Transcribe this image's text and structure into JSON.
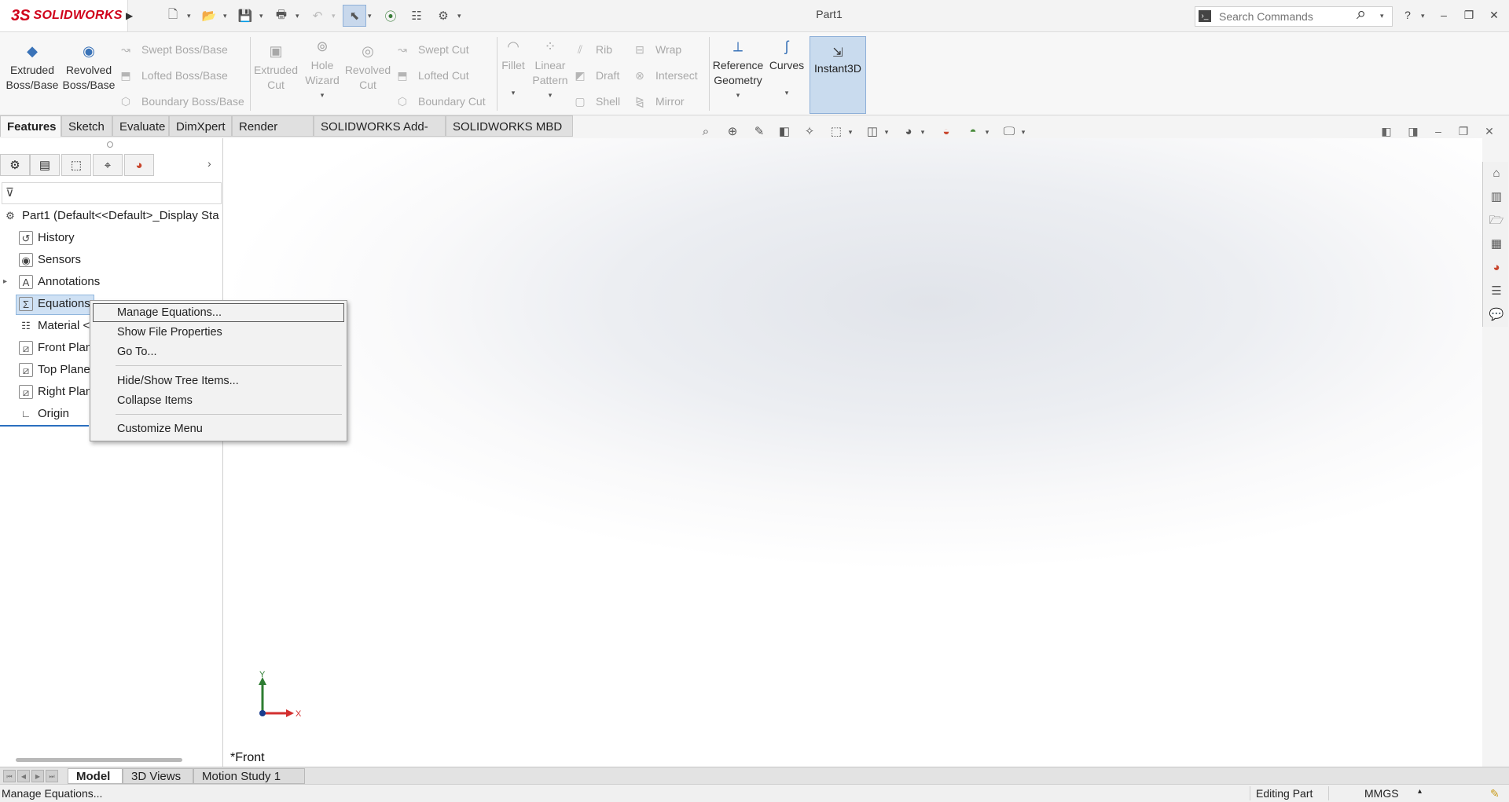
{
  "app": {
    "brand": "SOLIDWORKS",
    "title": "Part1",
    "search_placeholder": "Search Commands",
    "help_label": "?"
  },
  "ribbon": {
    "extruded_boss": "Extruded Boss/Base",
    "revolved_boss": "Revolved Boss/Base",
    "swept_boss": "Swept Boss/Base",
    "lofted_boss": "Lofted Boss/Base",
    "boundary_boss": "Boundary Boss/Base",
    "extruded_cut": "Extruded Cut",
    "hole_wizard": "Hole Wizard",
    "revolved_cut": "Revolved Cut",
    "swept_cut": "Swept Cut",
    "lofted_cut": "Lofted Cut",
    "boundary_cut": "Boundary Cut",
    "fillet": "Fillet",
    "linear_pattern": "Linear Pattern",
    "rib": "Rib",
    "draft": "Draft",
    "shell": "Shell",
    "wrap": "Wrap",
    "intersect": "Intersect",
    "mirror": "Mirror",
    "reference_geometry": "Reference Geometry",
    "curves": "Curves",
    "instant3d": "Instant3D"
  },
  "tabs": [
    "Features",
    "Sketch",
    "Evaluate",
    "DimXpert",
    "Render Tools",
    "SOLIDWORKS Add-Ins",
    "SOLIDWORKS MBD"
  ],
  "tree": {
    "root": "Part1  (Default<<Default>_Display Sta",
    "items": [
      "History",
      "Sensors",
      "Annotations",
      "Equations",
      "Material <",
      "Front Plan",
      "Top Plane",
      "Right Plan",
      "Origin"
    ]
  },
  "context_menu": {
    "items": [
      "Manage Equations...",
      "Show File Properties",
      "Go To...",
      "Hide/Show Tree Items...",
      "Collapse Items",
      "Customize Menu"
    ]
  },
  "viewport": {
    "view_label": "*Front",
    "axis_x": "X",
    "axis_y": "Y"
  },
  "bottom_tabs": [
    "Model",
    "3D Views",
    "Motion Study 1"
  ],
  "status": {
    "message": "Manage Equations...",
    "mode": "Editing Part",
    "units": "MMGS"
  }
}
